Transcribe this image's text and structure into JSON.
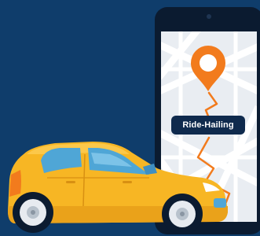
{
  "illustration": {
    "label": "Ride-Hailing",
    "colors": {
      "background": "#0f3d6b",
      "phone_frame": "#0b1b30",
      "map_background": "#e9edf2",
      "map_streets": "#ffffff",
      "pin": "#f27b1d",
      "route": "#f27b1d",
      "car_body": "#f7b624",
      "car_windows": "#4fa6d6",
      "label_background": "#0f2a4d"
    }
  }
}
